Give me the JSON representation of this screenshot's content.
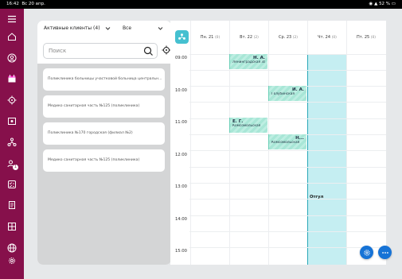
{
  "status_bar": {
    "time": "16:42",
    "date": "Вс 20 апр.",
    "battery": "52 %"
  },
  "sidebar": {
    "icons": [
      "menu-icon",
      "home-icon",
      "user-icon",
      "calendar-icon",
      "location-icon",
      "schedule-icon",
      "network-icon",
      "users-icon",
      "checklist-icon",
      "book-icon",
      "grid-icon",
      "globe-icon",
      "settings-icon"
    ],
    "users_badge": "1"
  },
  "clients": {
    "filter_label": "Активные клиенты (4)",
    "scope_label": "Все",
    "search_placeholder": "Поиск",
    "items": [
      "Поликлиника больницы участковой больница центральн...",
      "Медико санитарная часть №125 (поликлиника)",
      "Поликлиника №170 городская (филиал №2)",
      "Медико санитарная часть №125 (поликлиника)"
    ]
  },
  "calendar": {
    "days": [
      {
        "label": "Пн. 21",
        "count": "(0)"
      },
      {
        "label": "Вт. 22",
        "count": "(2)"
      },
      {
        "label": "Ср. 23",
        "count": "(2)"
      },
      {
        "label": "Чт. 24",
        "count": "(0)"
      },
      {
        "label": "Пт. 25",
        "count": "(0)"
      }
    ],
    "times": [
      "09:00",
      "10:00",
      "11:00",
      "12:00",
      "13:00",
      "14:00",
      "15:00"
    ],
    "events": [
      {
        "initials": "Н. А.",
        "location": "Ленинградская Заречн..."
      },
      {
        "initials": "И. А.",
        "location": "Голубинская"
      },
      {
        "initials": "Е. Г.",
        "location": "Комсомольская"
      },
      {
        "initials": "Н...",
        "location": "Комсомольская"
      }
    ],
    "today_note": "Отгул",
    "accent_color": "#45c0d0",
    "today_color": "#c5eef2"
  },
  "fab": {
    "settings": "gear-icon",
    "more": "more-icon"
  },
  "colors": {
    "sidebar": "#86104b",
    "fab": "#1673d6"
  }
}
